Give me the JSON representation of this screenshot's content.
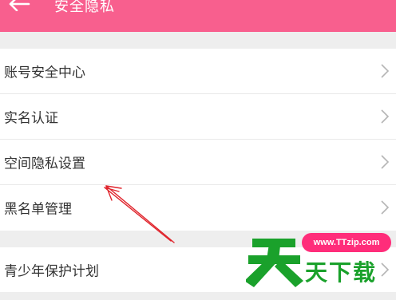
{
  "header": {
    "title": "安全隐私",
    "background_color": "#f85f8e",
    "back_icon": "arrow-left-icon"
  },
  "settings_groups": [
    {
      "items": [
        {
          "label": "账号安全中心"
        },
        {
          "label": "实名认证"
        },
        {
          "label": "空间隐私设置"
        },
        {
          "label": "黑名单管理"
        }
      ]
    },
    {
      "items": [
        {
          "label": "青少年保护计划"
        }
      ]
    }
  ],
  "annotation": {
    "type": "arrow",
    "color": "#e0242c",
    "points_to": "空间隐私设置"
  },
  "watermark": {
    "url": "www.TTzip.com",
    "tagline": "天下载",
    "logo_char": "天",
    "logo_color": "#1aa12b",
    "url_badge_color": "#ff2d7a"
  }
}
